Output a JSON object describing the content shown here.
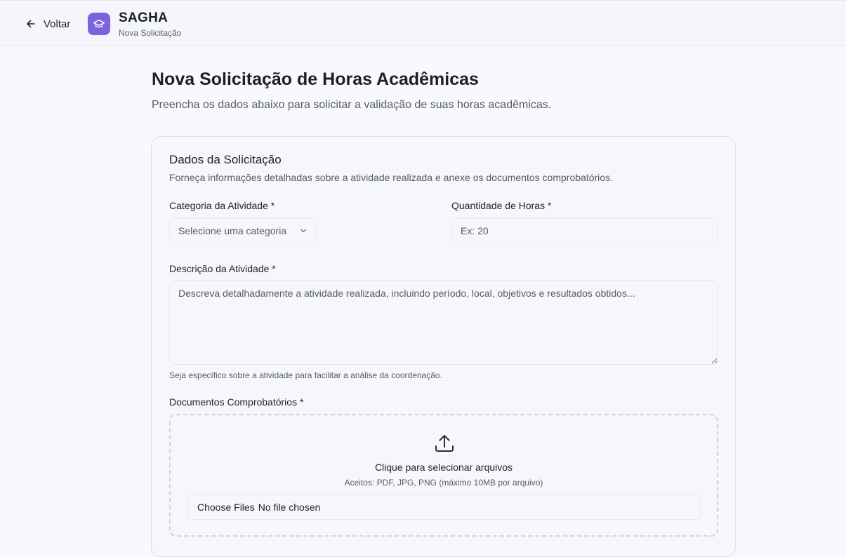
{
  "header": {
    "back_label": "Voltar",
    "brand": "SAGHA",
    "subtitle": "Nova Solicitação"
  },
  "page": {
    "title": "Nova Solicitação de Horas Acadêmicas",
    "subtitle": "Preencha os dados abaixo para solicitar a validação de suas horas acadêmicas."
  },
  "form": {
    "title": "Dados da Solicitação",
    "description": "Forneça informações detalhadas sobre a atividade realizada e anexe os documentos comprobatórios.",
    "category": {
      "label": "Categoria da Atividade *",
      "placeholder": "Selecione uma categoria"
    },
    "hours": {
      "label": "Quantidade de Horas *",
      "placeholder": "Ex: 20"
    },
    "description_field": {
      "label": "Descrição da Atividade *",
      "placeholder": "Descreva detalhadamente a atividade realizada, incluindo período, local, objetivos e resultados obtidos...",
      "hint": "Seja específico sobre a atividade para facilitar a análise da coordenação."
    },
    "documents": {
      "label": "Documentos Comprobatórios *",
      "drop_title": "Clique para selecionar arquivos",
      "drop_subtitle": "Aceitos: PDF, JPG, PNG (máximo 10MB por arquivo)",
      "choose_button": "Choose Files",
      "file_status": "No file chosen"
    }
  },
  "colors": {
    "accent": "#7b63e0",
    "background": "#f8f9fc"
  },
  "icons": {
    "back": "arrow-left-icon",
    "logo": "graduation-cap-icon",
    "select": "chevron-down-icon",
    "upload": "upload-icon"
  }
}
